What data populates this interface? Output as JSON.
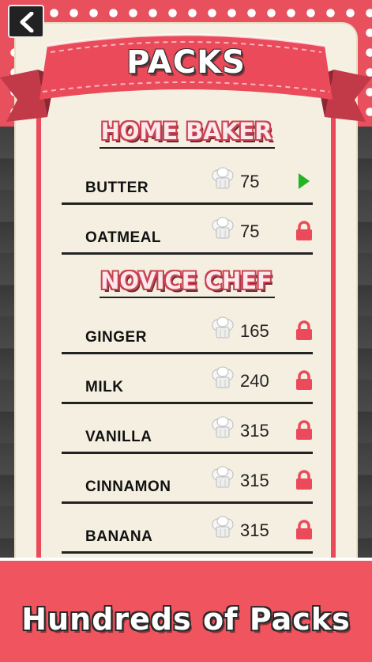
{
  "header": {
    "title": "PACKS",
    "back_icon": "chevron-left-icon"
  },
  "colors": {
    "accent": "#e8505e",
    "paper": "#f4efe0",
    "unlocked": "#22b422",
    "locked": "#ea4a5a"
  },
  "sections": [
    {
      "title": "HOME BAKER",
      "packs": [
        {
          "name": "BUTTER",
          "price": "75",
          "status": "play",
          "icon": "chef-hat-icon"
        },
        {
          "name": "OATMEAL",
          "price": "75",
          "status": "locked",
          "icon": "chef-hat-icon"
        }
      ]
    },
    {
      "title": "NOVICE CHEF",
      "packs": [
        {
          "name": "GINGER",
          "price": "165",
          "status": "locked",
          "icon": "chef-hat-icon"
        },
        {
          "name": "MILK",
          "price": "240",
          "status": "locked",
          "icon": "chef-hat-icon"
        },
        {
          "name": "VANILLA",
          "price": "315",
          "status": "locked",
          "icon": "chef-hat-icon"
        },
        {
          "name": "CINNAMON",
          "price": "315",
          "status": "locked",
          "icon": "chef-hat-icon"
        },
        {
          "name": "BANANA",
          "price": "315",
          "status": "locked",
          "icon": "chef-hat-icon"
        }
      ]
    }
  ],
  "promo": {
    "text": "Hundreds of Packs"
  }
}
